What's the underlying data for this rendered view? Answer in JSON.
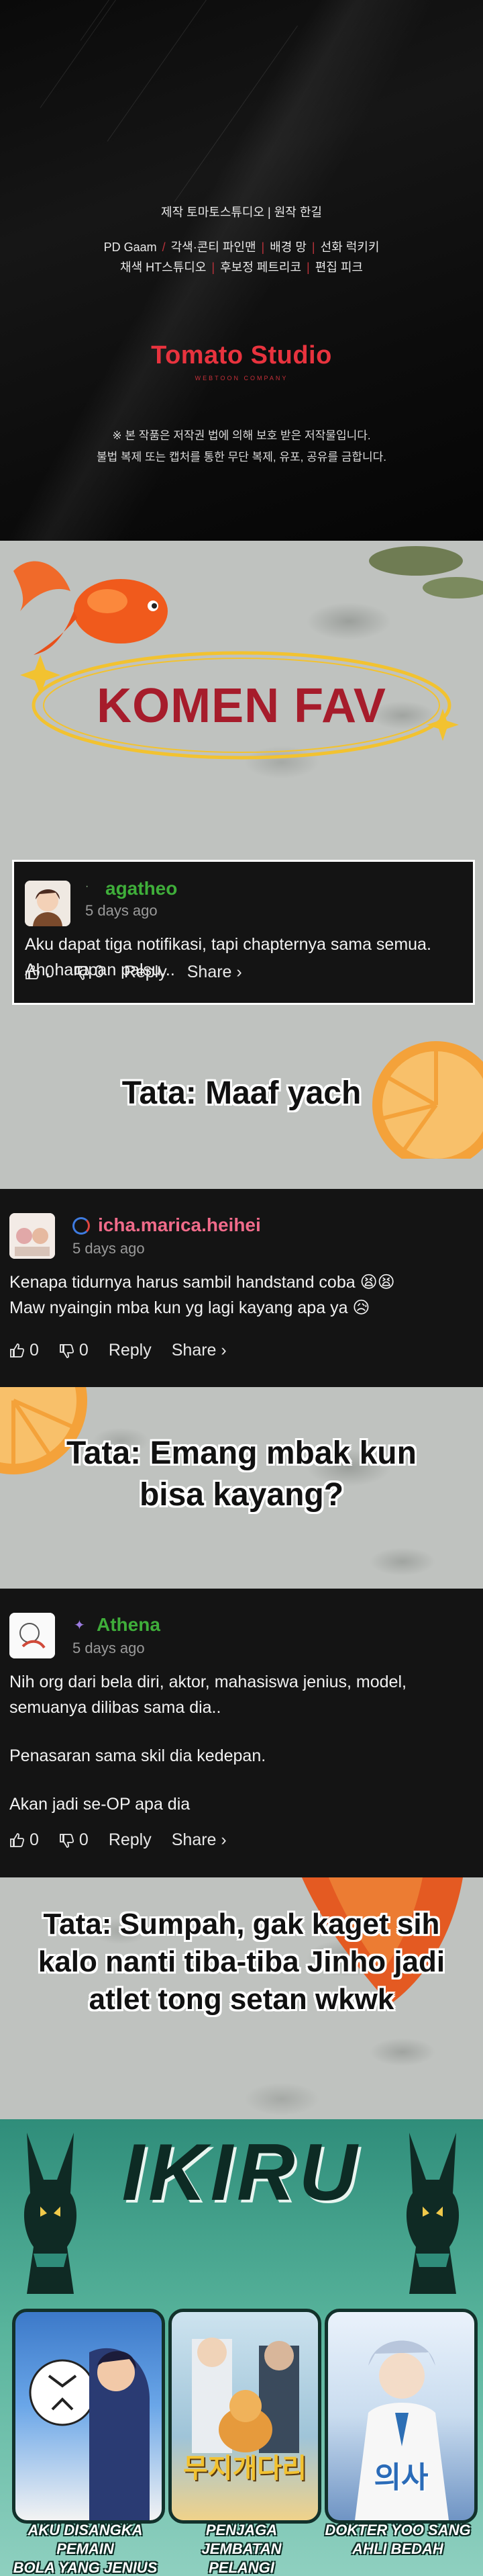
{
  "credits": {
    "line1": "제작 토마토스튜디오 | 원작 한길",
    "line2": [
      "PD Gaam",
      "각색·콘티 파인맨",
      "배경 망",
      "선화 럭키키"
    ],
    "line3": [
      "채색 HT스튜디오",
      "후보정 페트리코",
      "편집 피크"
    ],
    "logo": "Tomato Studio",
    "logo_sub": "WEBTOON COMPANY",
    "notice1": "※ 본 작품은 저작권 법에 의해 보호 받은 저작물입니다.",
    "notice2": "불법 복제 또는 캡처를 통한 무단 복제, 유포, 공유를 금합니다."
  },
  "banner": {
    "title": "KOMEN FAV"
  },
  "comments": [
    {
      "username": "agatheo",
      "badge": "·",
      "date": "5 days ago",
      "lines": [
        "Aku dapat tiga notifikasi, tapi chapternya sama semua.",
        "Ah, harapan palsu..."
      ],
      "likes": "0",
      "dislikes": "0",
      "reply": "Reply",
      "share": "Share ›",
      "name_color": "#3fae3a"
    },
    {
      "username": "icha.marica.heihei",
      "date": "5 days ago",
      "lines": [
        "Kenapa tidurnya harus sambil handstand coba 😫😫",
        "Maw nyaingin mba kun yg lagi kayang apa ya 😥"
      ],
      "likes": "0",
      "dislikes": "0",
      "reply": "Reply",
      "share": "Share ›",
      "name_color": "#f06b8a"
    },
    {
      "username": "Athena",
      "badge": "✦",
      "date": "5 days ago",
      "lines": [
        "Nih org dari bela diri, aktor, mahasiswa jenius, model,",
        "semuanya dilibas sama dia..",
        "",
        "Penasaran sama skil dia kedepan.",
        "",
        "Akan jadi se-OP apa dia"
      ],
      "likes": "0",
      "dislikes": "0",
      "reply": "Reply",
      "share": "Share ›",
      "name_color": "#3fae3a"
    }
  ],
  "replies": [
    {
      "text": "Tata: Maaf yach"
    },
    {
      "lines": [
        "Tata: Emang mbak kun",
        "bisa kayang?"
      ]
    },
    {
      "lines": [
        "Tata: Sumpah, gak kaget sih",
        "kalo nanti tiba-tiba Jinho jadi",
        "atlet tong setan wkwk"
      ]
    }
  ],
  "ikiru": {
    "title": "IKIRU",
    "cards": [
      {
        "caption": [
          "AKU DISANGKA PEMAIN",
          "BOLA YANG JENIUS"
        ]
      },
      {
        "caption": [
          "PENJAGA JEMBATAN",
          "PELANGI"
        ],
        "cover_text": "무지개다리"
      },
      {
        "caption": [
          "DOKTER YOO SANG",
          "AHLI BEDAH"
        ],
        "cover_text": "의사"
      }
    ]
  },
  "colors": {
    "accent": "#e8333e",
    "card_bg": "#141414",
    "banner_red": "#a61c2b",
    "ikiru_teal": "#3c9a84"
  }
}
